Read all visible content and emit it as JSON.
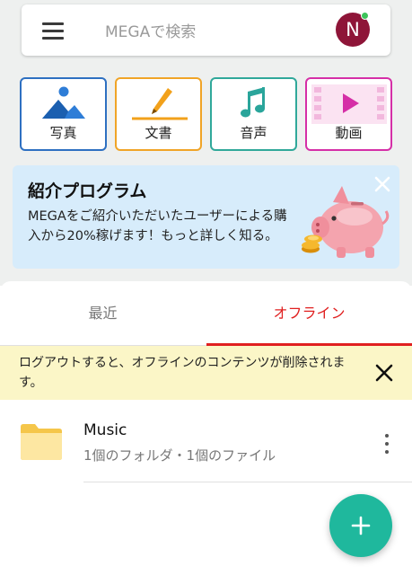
{
  "search": {
    "placeholder": "MEGAで検索"
  },
  "account": {
    "avatar_initial": "N"
  },
  "categories": [
    {
      "label": "写真",
      "icon": "photo-icon",
      "color": "#2e70c1"
    },
    {
      "label": "文書",
      "icon": "document-icon",
      "color": "#f0a427"
    },
    {
      "label": "音声",
      "icon": "audio-icon",
      "color": "#30a89a"
    },
    {
      "label": "動画",
      "icon": "video-icon",
      "color": "#d52fa7"
    }
  ],
  "banner": {
    "title": "紹介プログラム",
    "text": "MEGAをご紹介いただいたユーザーによる購入から20%稼げます！もっと詳しく知る。"
  },
  "tabs": [
    {
      "label": "最近",
      "active": false
    },
    {
      "label": "オフライン",
      "active": true
    }
  ],
  "warning": {
    "text": "ログアウトすると、オフラインのコンテンツが削除されます。"
  },
  "items": [
    {
      "name": "Music",
      "info": "1個のフォルダ・1個のファイル",
      "icon": "folder-icon"
    }
  ],
  "colors": {
    "accent": "#e02020",
    "fab": "#1fb89d",
    "avatar": "#8e1538"
  }
}
